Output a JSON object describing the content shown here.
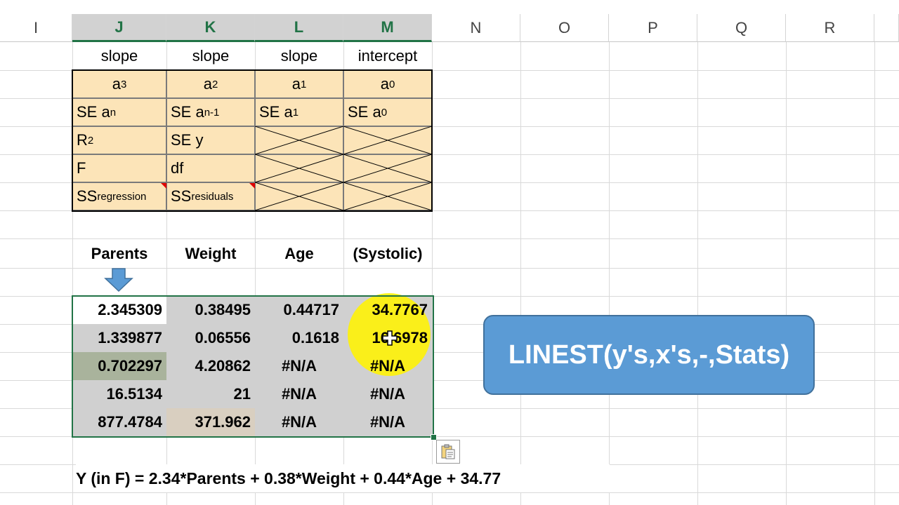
{
  "columns": [
    "I",
    "J",
    "K",
    "L",
    "M",
    "N",
    "O",
    "P",
    "Q",
    "R"
  ],
  "header_row": [
    "slope",
    "slope",
    "slope",
    "intercept"
  ],
  "legend": {
    "row1": [
      {
        "base": "a",
        "sub": "3"
      },
      {
        "base": "a",
        "sub": "2"
      },
      {
        "base": "a",
        "sub": "1"
      },
      {
        "base": "a",
        "sub": "0"
      }
    ],
    "row2": [
      {
        "base": "SE a",
        "sub": "n"
      },
      {
        "base": "SE a",
        "sub": "n-1"
      },
      {
        "base": "SE a",
        "sub": "1"
      },
      {
        "base": "SE a",
        "sub": "0"
      }
    ],
    "row3": {
      "r2_base": "R",
      "r2_sup": "2",
      "se_y": "SE y"
    },
    "row4": {
      "f": "F",
      "df": "df"
    },
    "row5": [
      {
        "base": "SS",
        "sub": "regression"
      },
      {
        "base": "SS",
        "sub": "residuals"
      }
    ]
  },
  "var_headers": [
    "Parents",
    "Weight",
    "Age",
    "(Systolic)"
  ],
  "results": [
    [
      "2.345309",
      "0.38495",
      "0.44717",
      "34.7767"
    ],
    [
      "1.339877",
      "0.06556",
      "0.1618",
      "16.6978"
    ],
    [
      "0.702297",
      "4.20862",
      "#N/A",
      "#N/A"
    ],
    [
      "16.5134",
      "21",
      "#N/A",
      "#N/A"
    ],
    [
      "877.4784",
      "371.962",
      "#N/A",
      "#N/A"
    ]
  ],
  "callout": "LINEST(y's,x's,-,Stats)",
  "equation": "Y (in F) = 2.34*Parents + 0.38*Weight + 0.44*Age + 34.77",
  "colors": {
    "accent": "#217346",
    "legend_fill": "#fce4b8",
    "callout": "#5b9bd5",
    "highlight": "#fff200"
  },
  "icons": [
    "down-arrow-icon",
    "paste-options-icon",
    "cursor-icon"
  ]
}
